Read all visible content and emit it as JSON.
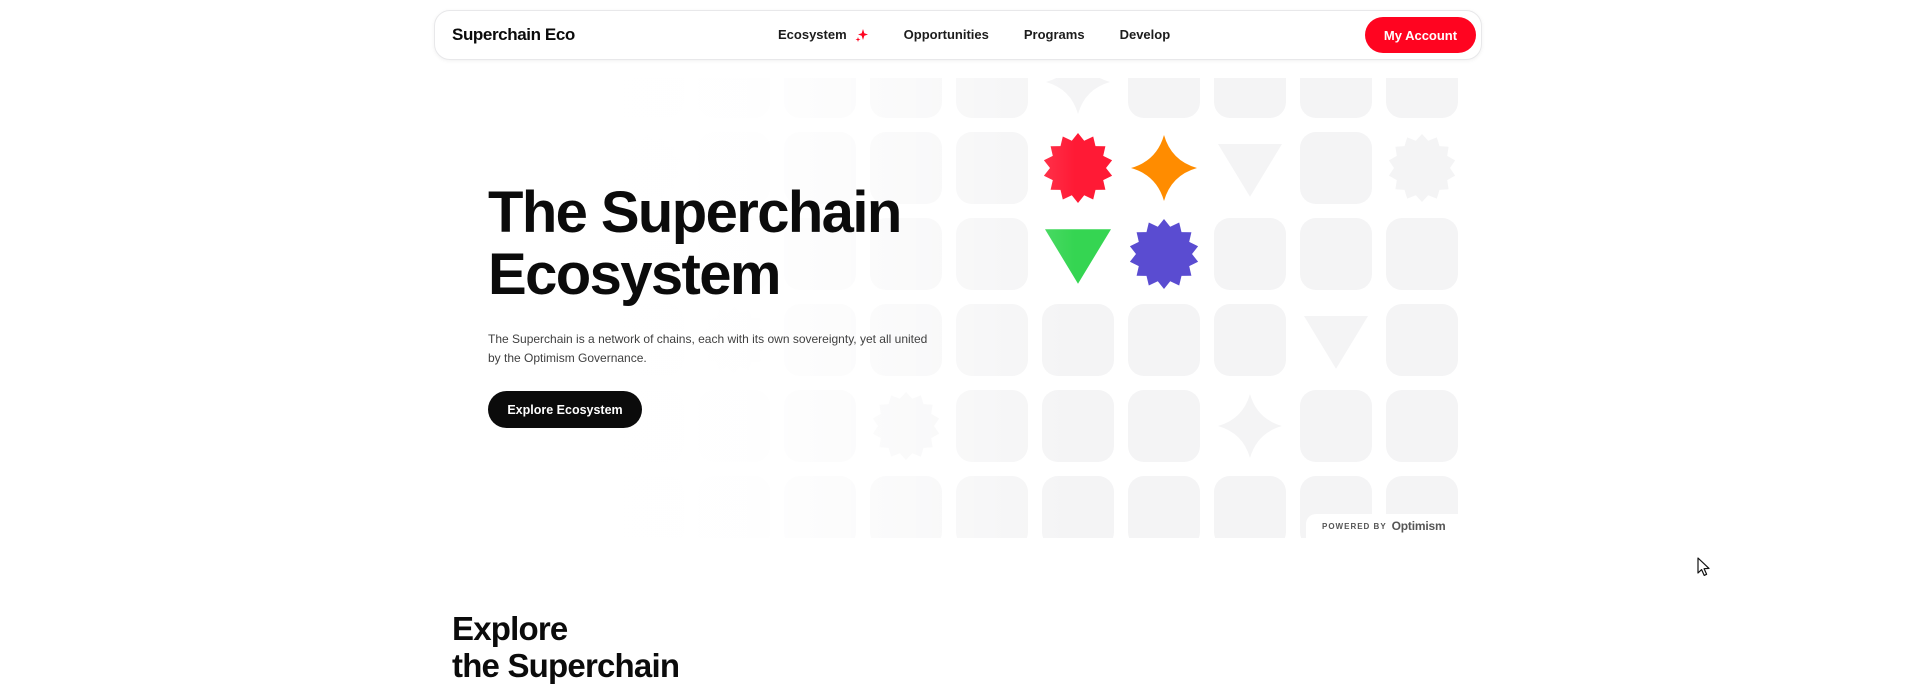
{
  "header": {
    "brand": "Superchain Eco",
    "nav_links": [
      "Ecosystem",
      "Opportunities",
      "Programs",
      "Develop"
    ],
    "account_label": "My Account"
  },
  "hero": {
    "title_line1": "The Superchain",
    "title_line2": "Ecosystem",
    "description": "The Superchain is a network of chains, each with its own sovereignty, yet all united by the Optimism Governance.",
    "cta_label": "Explore Ecosystem"
  },
  "powered_by": {
    "label": "POWERED BY",
    "name": "Optimism"
  },
  "explore_section": {
    "title_line1": "Explore",
    "title_line2": "the Superchain"
  },
  "icons": {
    "ecosystem_sparkle": "sparkle-icon",
    "cursor": "cursor-icon"
  },
  "colors": {
    "accent_red": "#ff0420",
    "shape_red": "#ff1a35",
    "shape_orange": "#ff8c00",
    "shape_green": "#35d552",
    "shape_purple": "#5a4cd1",
    "tile_gray": "#f4f4f5"
  }
}
